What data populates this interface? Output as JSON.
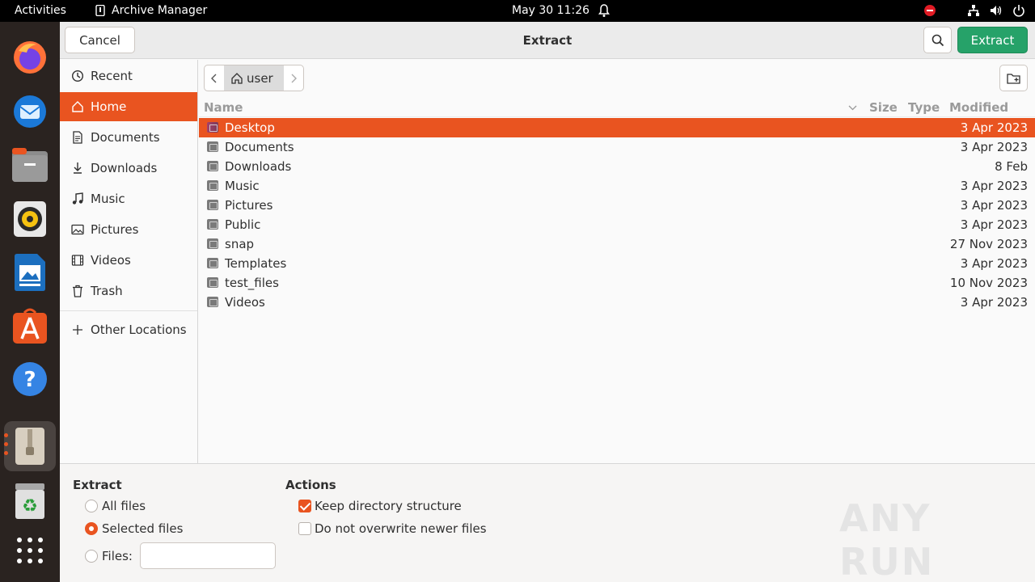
{
  "topbar": {
    "activities": "Activities",
    "app_name": "Archive Manager",
    "datetime": "May 30  11:26"
  },
  "dock": {
    "apps": [
      "firefox-icon",
      "thunderbird-icon",
      "files-icon",
      "rhythmbox-icon",
      "libreoffice-writer-icon",
      "app-center-icon",
      "help-icon",
      "archive-manager-icon",
      "trash-icon",
      "show-apps-icon"
    ]
  },
  "header": {
    "cancel": "Cancel",
    "title": "Extract",
    "extract": "Extract"
  },
  "sidebar": {
    "items": [
      {
        "label": "Recent"
      },
      {
        "label": "Home"
      },
      {
        "label": "Documents"
      },
      {
        "label": "Downloads"
      },
      {
        "label": "Music"
      },
      {
        "label": "Pictures"
      },
      {
        "label": "Videos"
      },
      {
        "label": "Trash"
      }
    ],
    "other": "Other Locations"
  },
  "pathbar": {
    "crumb": "user"
  },
  "columns": {
    "name": "Name",
    "size": "Size",
    "type": "Type",
    "modified": "Modified"
  },
  "files": [
    {
      "name": "Desktop",
      "modified": "3 Apr 2023"
    },
    {
      "name": "Documents",
      "modified": "3 Apr 2023"
    },
    {
      "name": "Downloads",
      "modified": "8 Feb"
    },
    {
      "name": "Music",
      "modified": "3 Apr 2023"
    },
    {
      "name": "Pictures",
      "modified": "3 Apr 2023"
    },
    {
      "name": "Public",
      "modified": "3 Apr 2023"
    },
    {
      "name": "snap",
      "modified": "27 Nov 2023"
    },
    {
      "name": "Templates",
      "modified": "3 Apr 2023"
    },
    {
      "name": "test_files",
      "modified": "10 Nov 2023"
    },
    {
      "name": "Videos",
      "modified": "3 Apr 2023"
    }
  ],
  "options": {
    "extract_heading": "Extract",
    "all_files": "All files",
    "selected_files": "Selected files",
    "files": "Files:",
    "files_value": "",
    "actions_heading": "Actions",
    "keep_structure": "Keep directory structure",
    "no_overwrite": "Do not overwrite newer files"
  },
  "watermark": "ANY RUN",
  "colors": {
    "accent": "#e95420",
    "extract_button": "#26a269"
  }
}
